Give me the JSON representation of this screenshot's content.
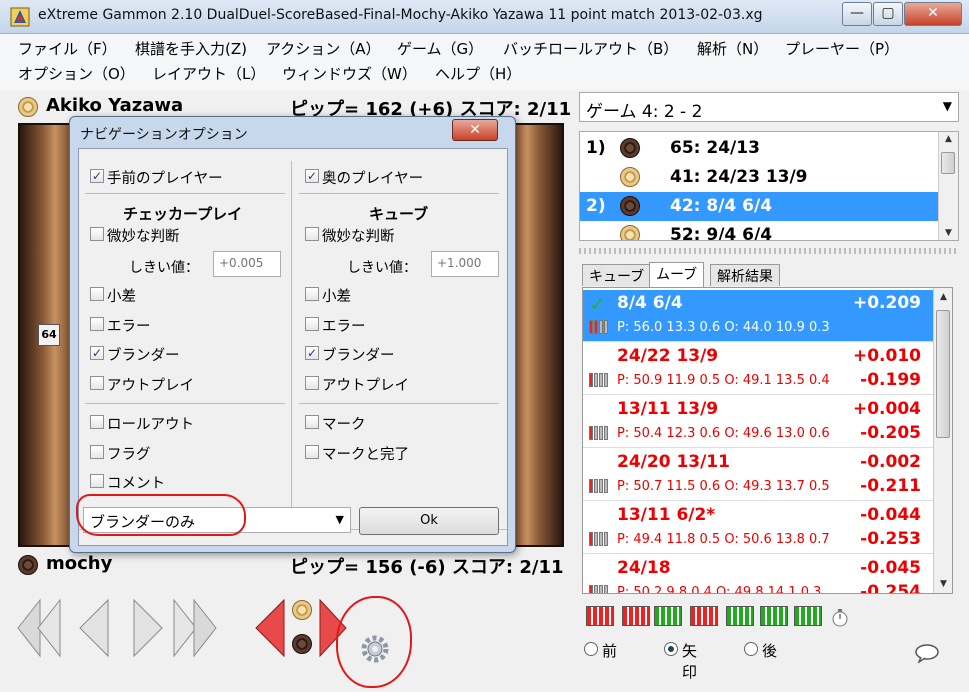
{
  "window": {
    "title": "eXtreme Gammon 2.10 DualDuel-ScoreBased-Final-Mochy-Akiko Yazawa 11 point match 2013-02-03.xg",
    "minimize": "—",
    "maximize": "▢",
    "close": "✕"
  },
  "menu": {
    "row1": [
      "ファイル（F）",
      "棋譜を手入力(Z)",
      "アクション（A）",
      "ゲーム（G）",
      "バッチロールアウト（B）",
      "解析（N）",
      "プレーヤー（P）"
    ],
    "row2": [
      "オプション（O）",
      "レイアウト（L）",
      "ウィンドウズ（W）",
      "ヘルプ（H）"
    ]
  },
  "top_player": {
    "name": "Akiko Yazawa",
    "stats": "ピップ= 162 (+6)   スコア: 2/11"
  },
  "bottom_player": {
    "name": "mochy",
    "stats": "ピップ= 156 (-6)   スコア: 2/11"
  },
  "board": {
    "cube_value": "64"
  },
  "game_select": {
    "value": "ゲーム 4: 2 - 2",
    "arrow": "▼"
  },
  "movelist": [
    {
      "num": "1)",
      "move": "65: 24/13",
      "checker": "dark",
      "selected": false
    },
    {
      "num": "",
      "move": "41: 24/23 13/9",
      "checker": "light",
      "selected": false
    },
    {
      "num": "2)",
      "move": "42: 8/4 6/4",
      "checker": "dark",
      "selected": true
    },
    {
      "num": "",
      "move": "52: 9/4 6/4",
      "checker": "light",
      "selected": false
    }
  ],
  "tabs": [
    "キューブ",
    "ムーブ",
    "解析結果"
  ],
  "analysis": [
    {
      "move": "8/4 6/4",
      "eq": "+0.209",
      "eq2": "",
      "stat": "P: 56.0 13.3 0.6    O: 44.0 10.9 0.3",
      "selected": true,
      "best": true
    },
    {
      "move": "24/22 13/9",
      "eq": "+0.010",
      "eq2": "-0.199",
      "stat": "P: 50.9 11.9 0.5    O: 49.1 13.5 0.4"
    },
    {
      "move": "13/11 13/9",
      "eq": "+0.004",
      "eq2": "-0.205",
      "stat": "P: 50.4 12.3 0.6    O: 49.6 13.0 0.6"
    },
    {
      "move": "24/20 13/11",
      "eq": "-0.002",
      "eq2": "-0.211",
      "stat": "P: 50.7 11.5 0.6    O: 49.3 13.7 0.5"
    },
    {
      "move": "13/11 6/2*",
      "eq": "-0.044",
      "eq2": "-0.253",
      "stat": "P: 49.4 11.8 0.5    O: 50.6 13.8 0.7"
    },
    {
      "move": "24/18",
      "eq": "-0.045",
      "eq2": "-0.254",
      "stat": "P: 50.2 9.8 0.4    O: 49.8 14.1 0.3"
    }
  ],
  "radios": {
    "prev": "前",
    "arrow": "矢印",
    "next": "後",
    "selected": "arrow"
  },
  "dialog": {
    "title": "ナビゲーションオプション",
    "close": "✕",
    "left_player": "手前のプレイヤー",
    "right_player": "奥のプレイヤー",
    "checker_head": "チェッカープレイ",
    "cube_head": "キューブ",
    "subtle": "微妙な判断",
    "threshold_label": "しきい値：",
    "threshold_left": "+0.005",
    "threshold_right": "+1.000",
    "small": "小差",
    "error": "エラー",
    "blunder": "ブランダー",
    "outplay": "アウトプレイ",
    "rollout": "ロールアウト",
    "mark": "マーク",
    "flag": "フラグ",
    "mark_done": "マークと完了",
    "comment": "コメント",
    "filter_value": "ブランダーのみ",
    "filter_arrow": "▼",
    "ok": "Ok",
    "check_mark": "✓"
  },
  "colors": {
    "accent": "#3399ff",
    "annotation": "#e01818",
    "error_text": "#e00000"
  }
}
